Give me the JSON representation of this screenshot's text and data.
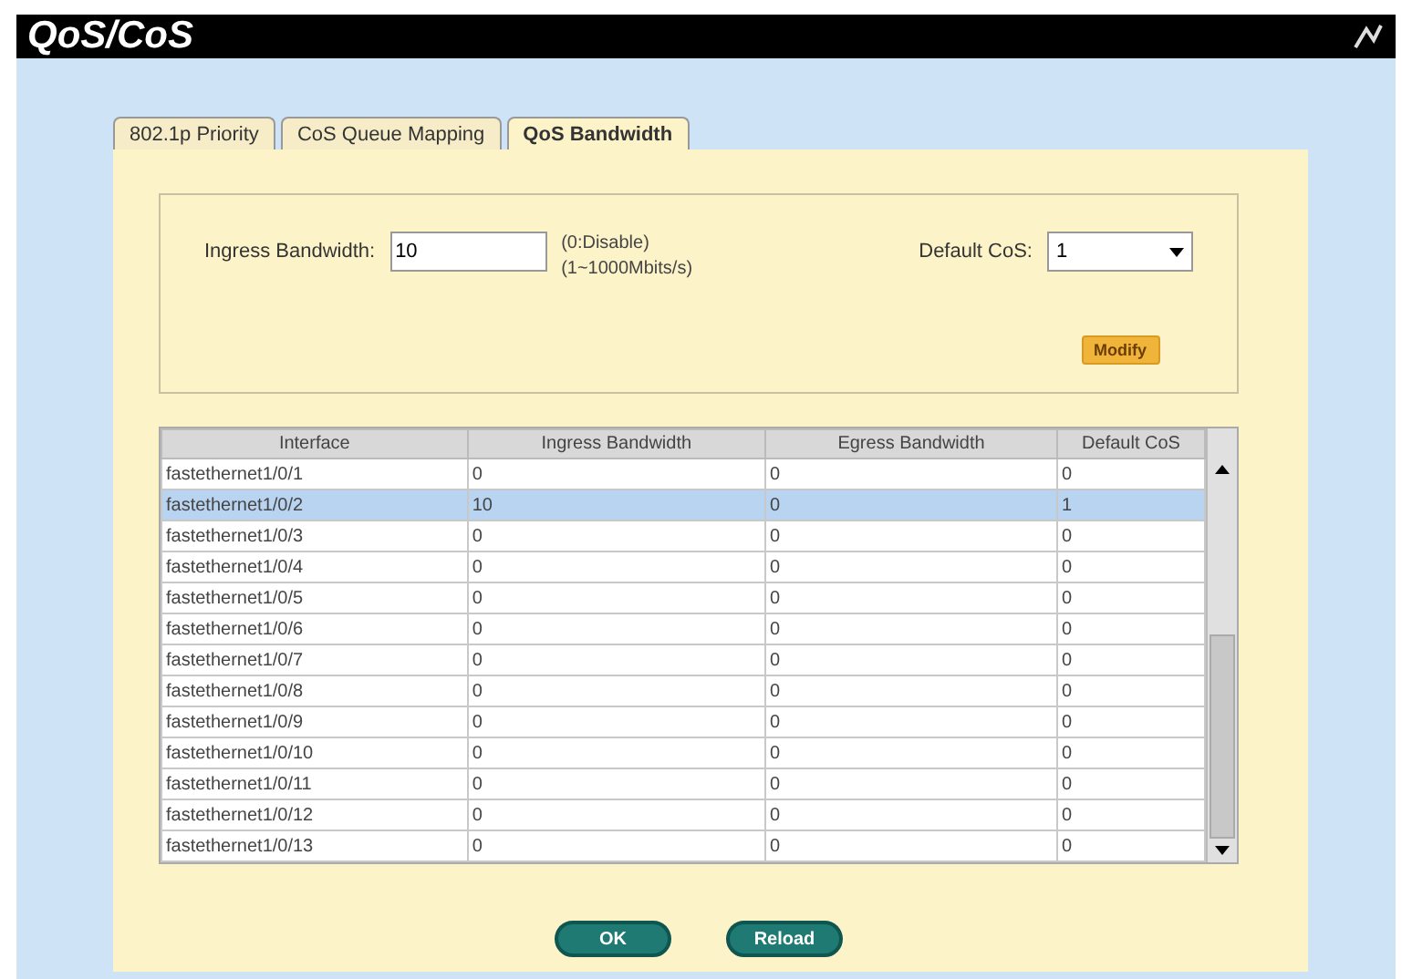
{
  "window": {
    "title": "QoS/CoS"
  },
  "tabs": [
    {
      "label": "802.1p Priority",
      "selected": false
    },
    {
      "label": "CoS Queue Mapping",
      "selected": false
    },
    {
      "label": "QoS Bandwidth",
      "selected": true
    }
  ],
  "form": {
    "ingress_label": "Ingress Bandwidth:",
    "ingress_value": "10",
    "hint_1": "(0:Disable)",
    "hint_2": "(1~1000Mbits/s)",
    "cos_label": "Default CoS:",
    "cos_value": "1",
    "modify_button": "Modify"
  },
  "table": {
    "columns": [
      "Interface",
      "Ingress Bandwidth",
      "Egress Bandwidth",
      "Default CoS"
    ],
    "rows": [
      {
        "cells": [
          "fastethernet1/0/1",
          "0",
          "0",
          "0"
        ],
        "selected": false
      },
      {
        "cells": [
          "fastethernet1/0/2",
          "10",
          "0",
          "1"
        ],
        "selected": true
      },
      {
        "cells": [
          "fastethernet1/0/3",
          "0",
          "0",
          "0"
        ],
        "selected": false
      },
      {
        "cells": [
          "fastethernet1/0/4",
          "0",
          "0",
          "0"
        ],
        "selected": false
      },
      {
        "cells": [
          "fastethernet1/0/5",
          "0",
          "0",
          "0"
        ],
        "selected": false
      },
      {
        "cells": [
          "fastethernet1/0/6",
          "0",
          "0",
          "0"
        ],
        "selected": false
      },
      {
        "cells": [
          "fastethernet1/0/7",
          "0",
          "0",
          "0"
        ],
        "selected": false
      },
      {
        "cells": [
          "fastethernet1/0/8",
          "0",
          "0",
          "0"
        ],
        "selected": false
      },
      {
        "cells": [
          "fastethernet1/0/9",
          "0",
          "0",
          "0"
        ],
        "selected": false
      },
      {
        "cells": [
          "fastethernet1/0/10",
          "0",
          "0",
          "0"
        ],
        "selected": false
      },
      {
        "cells": [
          "fastethernet1/0/11",
          "0",
          "0",
          "0"
        ],
        "selected": false
      },
      {
        "cells": [
          "fastethernet1/0/12",
          "0",
          "0",
          "0"
        ],
        "selected": false
      },
      {
        "cells": [
          "fastethernet1/0/13",
          "0",
          "0",
          "0"
        ],
        "selected": false
      }
    ]
  },
  "buttons": [
    "OK",
    "Reload"
  ]
}
